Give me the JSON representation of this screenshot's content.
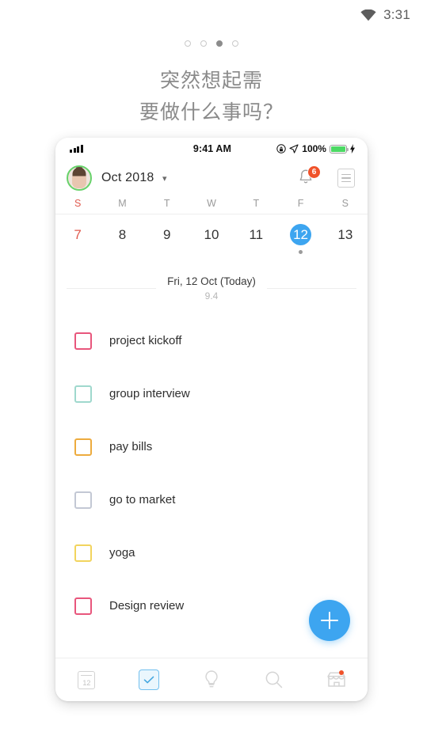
{
  "system_bar": {
    "icon": "wifi-icon",
    "time": "3:31"
  },
  "carousel": {
    "count": 4,
    "active_index": 2
  },
  "headline": {
    "line1": "突然想起需",
    "line2": "要做什么事吗？"
  },
  "phone": {
    "ios_status": {
      "signal_icon": "signal-bars-icon",
      "time": "9:41 AM",
      "rotation_lock_icon": "rotation-lock-icon",
      "location_icon": "location-arrow-icon",
      "battery_percent": "100%",
      "battery_icon": "battery-full-icon",
      "charging_icon": "charging-bolt-icon",
      "battery_color": "#4cd964"
    },
    "header": {
      "avatar": "user-avatar",
      "avatar_ring_color": "#67d26a",
      "month_label": "Oct 2018",
      "chevron_icon": "chevron-down-icon",
      "bell_icon": "bell-icon",
      "notification_count": "6",
      "badge_color": "#f0522a",
      "menu_icon": "list-menu-icon"
    },
    "calendar": {
      "weekdays": [
        "S",
        "M",
        "T",
        "W",
        "T",
        "F",
        "S"
      ],
      "days": [
        {
          "num": "7",
          "sunday": true,
          "selected": false,
          "has_event": false
        },
        {
          "num": "8",
          "sunday": false,
          "selected": false,
          "has_event": false
        },
        {
          "num": "9",
          "sunday": false,
          "selected": false,
          "has_event": false
        },
        {
          "num": "10",
          "sunday": false,
          "selected": false,
          "has_event": false
        },
        {
          "num": "11",
          "sunday": false,
          "selected": false,
          "has_event": false
        },
        {
          "num": "12",
          "sunday": false,
          "selected": true,
          "has_event": true
        },
        {
          "num": "13",
          "sunday": false,
          "selected": false,
          "has_event": false
        }
      ],
      "selected_color": "#3da5f0",
      "sunday_color": "#e05a4e"
    },
    "today": {
      "title": "Fri, 12 Oct (Today)",
      "subtitle": "9.4"
    },
    "tasks": [
      {
        "label": "project kickoff",
        "color": "#e8567c",
        "checked": false
      },
      {
        "label": "group interview",
        "color": "#9fd8cd",
        "checked": false
      },
      {
        "label": "pay bills",
        "color": "#edab3e",
        "checked": false
      },
      {
        "label": "go to market",
        "color": "#c3c8d4",
        "checked": false
      },
      {
        "label": "yoga",
        "color": "#f2d45e",
        "checked": false
      },
      {
        "label": "Design review",
        "color": "#e8567c",
        "checked": false
      }
    ],
    "fab": {
      "icon": "plus-icon",
      "color": "#3da5f0"
    },
    "nav": [
      {
        "icon": "calendar-icon",
        "label": "12",
        "active": false,
        "dot": false
      },
      {
        "icon": "checkbox-icon",
        "label": "",
        "active": true,
        "dot": false
      },
      {
        "icon": "lightbulb-icon",
        "label": "",
        "active": false,
        "dot": false
      },
      {
        "icon": "search-icon",
        "label": "",
        "active": false,
        "dot": false
      },
      {
        "icon": "store-icon",
        "label": "",
        "active": false,
        "dot": true
      }
    ]
  }
}
